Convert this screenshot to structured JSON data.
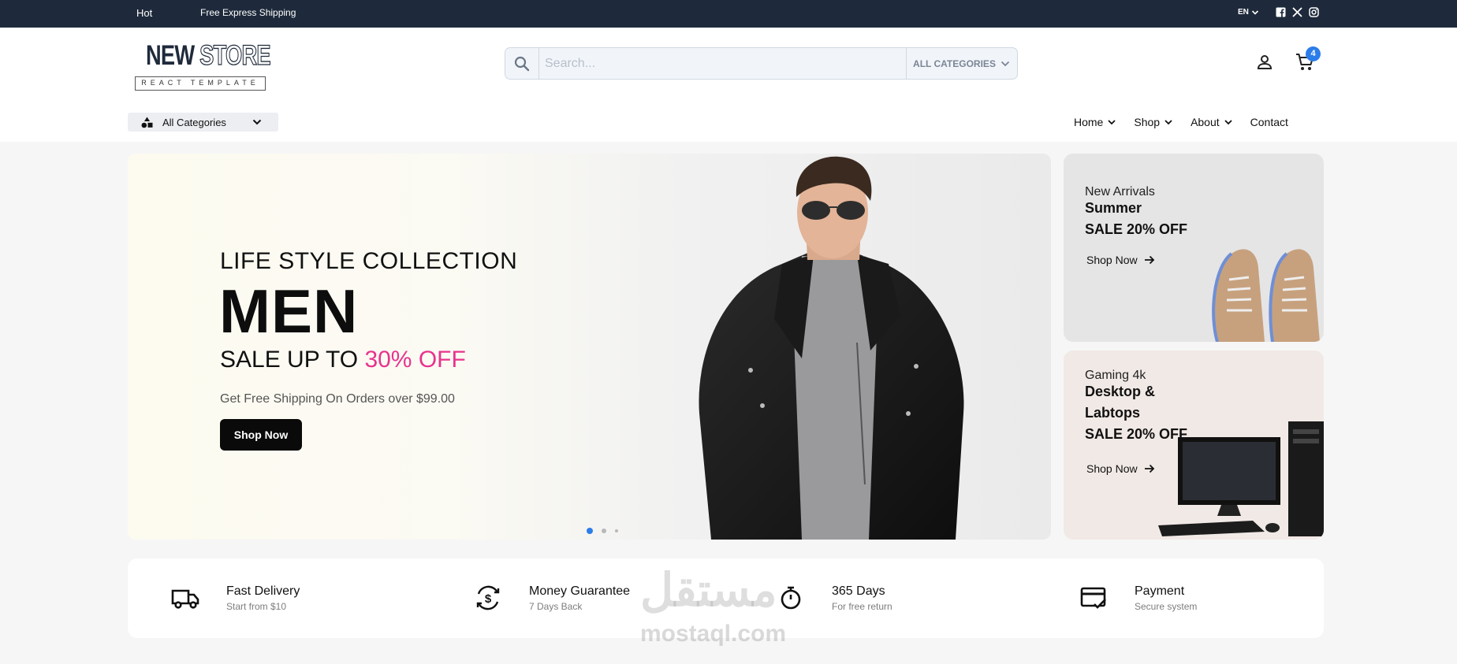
{
  "topbar": {
    "hot": "Hot",
    "shipping": "Free Express Shipping",
    "language": "EN",
    "socials": [
      "facebook-icon",
      "x-icon",
      "instagram-icon"
    ]
  },
  "header": {
    "logo_word1": "NEW",
    "logo_word2": "STORE",
    "logo_tagline": "REACT TEMPLATE",
    "search_placeholder": "Search...",
    "search_category": "ALL CATEGORIES",
    "cart_count": "4"
  },
  "menu": {
    "all_categories": "All Categories",
    "nav": [
      "Home",
      "Shop",
      "About",
      "Contact"
    ]
  },
  "hero": {
    "subtitle": "LIFE STYLE COLLECTION",
    "title": "MEN",
    "sale_prefix": "SALE UP TO ",
    "sale_percent": "30% OFF",
    "shipping": "Get Free Shipping On Orders over $99.00",
    "button": "Shop Now",
    "slides": 3,
    "active_slide": 1
  },
  "banners": [
    {
      "small": "New Arrivals",
      "line1": "Summer",
      "line2": "SALE 20% OFF",
      "link": "Shop Now"
    },
    {
      "small": "Gaming 4k",
      "line1": "Desktop &",
      "line2": "Labtops",
      "line3": "SALE 20% OFF",
      "link": "Shop Now"
    }
  ],
  "features": [
    {
      "title": "Fast Delivery",
      "subtitle": "Start from $10",
      "icon": "truck-icon"
    },
    {
      "title": "Money Guarantee",
      "subtitle": "7 Days Back",
      "icon": "money-back-icon"
    },
    {
      "title": "365 Days",
      "subtitle": "For free return",
      "icon": "stopwatch-icon"
    },
    {
      "title": "Payment",
      "subtitle": "Secure system",
      "icon": "credit-card-icon"
    }
  ],
  "watermark": {
    "arabic": "مستقل",
    "latin": "mostaql.com"
  },
  "colors": {
    "topbar_bg": "#1e2a3b",
    "accent_pink": "#e8338d",
    "badge_blue": "#2b7de9"
  }
}
